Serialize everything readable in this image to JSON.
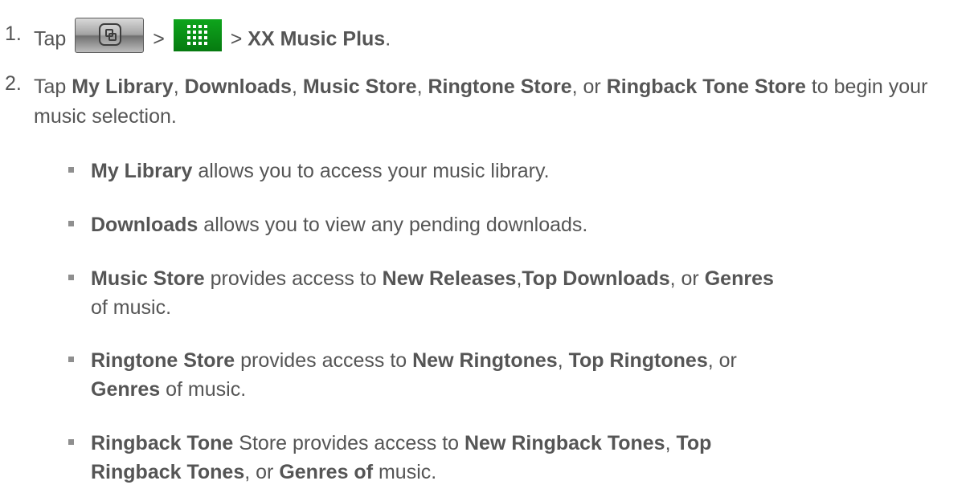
{
  "steps": [
    {
      "number": "1.",
      "tap": "Tap",
      "sep1": ">",
      "sep2": ">",
      "target": "XX Music Plus",
      "end": "."
    },
    {
      "number": "2.",
      "tap": "Tap",
      "items": [
        "My Library",
        "Downloads",
        "Music Store",
        "Ringtone Store",
        "Ringback Tone Store"
      ],
      "comma": ",",
      "or": ", or",
      "end": "to begin your music selection."
    }
  ],
  "icons": {
    "home": "home-button-icon",
    "apps": "apps-grid-icon",
    "apps_color": "#0a9416"
  },
  "bullets": [
    {
      "bold": "My Library",
      "text": "allows you to access your music library."
    },
    {
      "bold": "Downloads",
      "text": "allows you to view any pending downloads."
    },
    {
      "bold": "Music Store",
      "t1": "provides access to",
      "b2": "New Releases",
      "t2": ",",
      "b3": "Top Downloads",
      "t3": ", or",
      "b4": "Genres",
      "t4": "of music."
    },
    {
      "bold": "Ringtone Store",
      "t1": "provides access to",
      "b2": "New Ringtones",
      "t2": ",",
      "b3": "Top Ringtones",
      "t3": ", or",
      "b4": "Genres",
      "t4": "of music."
    },
    {
      "bold": "Ringback Tone",
      "t1": "Store provides access to",
      "b2": "New Ringback Tones",
      "t2": ",",
      "b3": "Top Ringback Tones",
      "t3": ", or",
      "b4": "Genres of",
      "t4": "music."
    }
  ]
}
